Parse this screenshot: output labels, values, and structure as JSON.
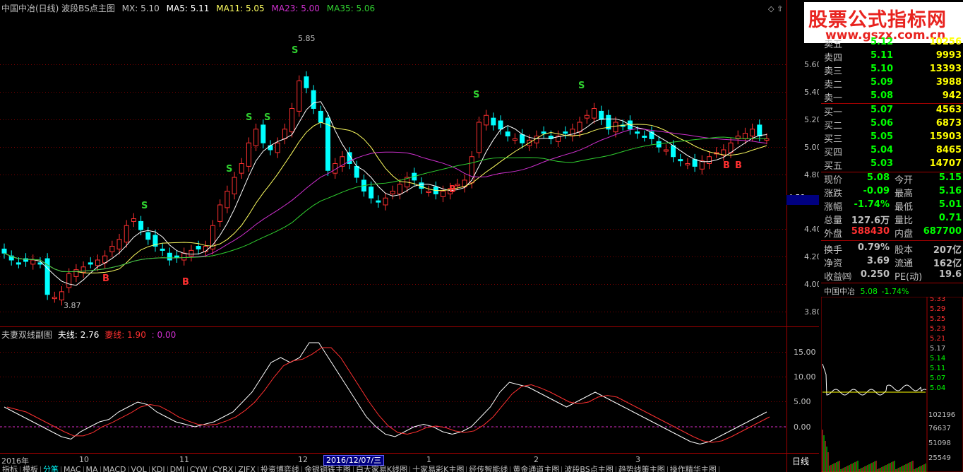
{
  "header": {
    "title": "中国中冶(日线) 波段BS点主图",
    "mx": "MX: 5.10",
    "ma5": "MA5: 5.11",
    "ma11": "MA11: 5.05",
    "ma23": "MA23: 5.00",
    "ma35": "MA35: 5.06"
  },
  "sub_indicator": {
    "name": "夫妻双线副图",
    "husband": "夫线: 2.76",
    "wife": "妻线: 1.90",
    "extra": ": 0.00"
  },
  "price_axis": [
    "5.60",
    "5.40",
    "5.20",
    "5.00",
    "4.80",
    "4.59",
    "4.40",
    "4.20",
    "4.00",
    "3.80"
  ],
  "sub_axis": [
    "15.00",
    "10.00",
    "5.00",
    "0.00"
  ],
  "annotations": {
    "high": "5.85",
    "low": "3.87"
  },
  "signals": {
    "sell": "S",
    "buy": "B"
  },
  "date_axis": [
    "2016年",
    "10",
    "11",
    "12",
    "1",
    "2",
    "3"
  ],
  "selected_date": "2016/12/07/三",
  "daily_button": "日线",
  "bottom_tabs": [
    "指标",
    "模板",
    "分笔",
    "MAC",
    "MA",
    "MACD",
    "VOL",
    "KDJ",
    "DMI",
    "CYW",
    "CYRX",
    "ZJFX",
    "投资博弈线",
    "金银铜铁主图",
    "白大家易K线图",
    "十家易彩K主图",
    "经传智能线",
    "黄金通道主图",
    "波段BS点主图",
    "趋势线策主图",
    "操作精华主图"
  ],
  "logo": {
    "main": "股票公式指标网",
    "url": "www.gszx.com.cn"
  },
  "quotes": {
    "sell": [
      {
        "label": "卖五",
        "price": "5.12",
        "vol": "10256"
      },
      {
        "label": "卖四",
        "price": "5.11",
        "vol": "9993"
      },
      {
        "label": "卖三",
        "price": "5.10",
        "vol": "13393"
      },
      {
        "label": "卖二",
        "price": "5.09",
        "vol": "3988"
      },
      {
        "label": "卖一",
        "price": "5.08",
        "vol": "942"
      }
    ],
    "buy": [
      {
        "label": "买一",
        "price": "5.07",
        "vol": "4563"
      },
      {
        "label": "买二",
        "price": "5.06",
        "vol": "6873"
      },
      {
        "label": "买三",
        "price": "5.05",
        "vol": "15903"
      },
      {
        "label": "买四",
        "price": "5.04",
        "vol": "8465"
      },
      {
        "label": "买五",
        "price": "5.03",
        "vol": "14707"
      }
    ]
  },
  "stats": [
    {
      "l1": "现价",
      "v1": "5.08",
      "c1": "#00ff00",
      "l2": "今开",
      "v2": "5.15",
      "c2": "#00ff00"
    },
    {
      "l1": "涨跌",
      "v1": "-0.09",
      "c1": "#00ff00",
      "l2": "最高",
      "v2": "5.16",
      "c2": "#00ff00"
    },
    {
      "l1": "涨幅",
      "v1": "-1.74%",
      "c1": "#00ff00",
      "l2": "最低",
      "v2": "5.01",
      "c2": "#00ff00"
    },
    {
      "l1": "总量",
      "v1": "127.6万",
      "c1": "#c0c0c0",
      "l2": "量比",
      "v2": "0.71",
      "c2": "#00ff00"
    },
    {
      "l1": "外盘",
      "v1": "588430",
      "c1": "#ff3030",
      "l2": "内盘",
      "v2": "687700",
      "c2": "#00ff00"
    },
    {
      "l1": "换手",
      "v1": "0.79%",
      "c1": "#c0c0c0",
      "l2": "股本",
      "v2": "207亿",
      "c2": "#c0c0c0"
    },
    {
      "l1": "净资",
      "v1": "3.69",
      "c1": "#c0c0c0",
      "l2": "流通",
      "v2": "162亿",
      "c2": "#c0c0c0"
    },
    {
      "l1": "收益㈣",
      "v1": "0.250",
      "c1": "#c0c0c0",
      "l2": "PE(动)",
      "v2": "19.6",
      "c2": "#c0c0c0"
    }
  ],
  "mini": {
    "name": "中国中冶",
    "price": "5.08",
    "change": "-1.74%",
    "price_axis": [
      "5.33",
      "5.29",
      "5.25",
      "5.23",
      "5.21",
      "5.17",
      "5.14",
      "5.11",
      "5.07",
      "5.04"
    ],
    "vol_axis": [
      "102196",
      "76637",
      "51098",
      "25549"
    ]
  },
  "colors": {
    "up": "#ff3030",
    "down": "#00ffff",
    "ma5": "#ffffff",
    "ma11": "#ffff60",
    "ma23": "#d030d0",
    "ma35": "#30d030",
    "frame": "#a00000"
  }
}
